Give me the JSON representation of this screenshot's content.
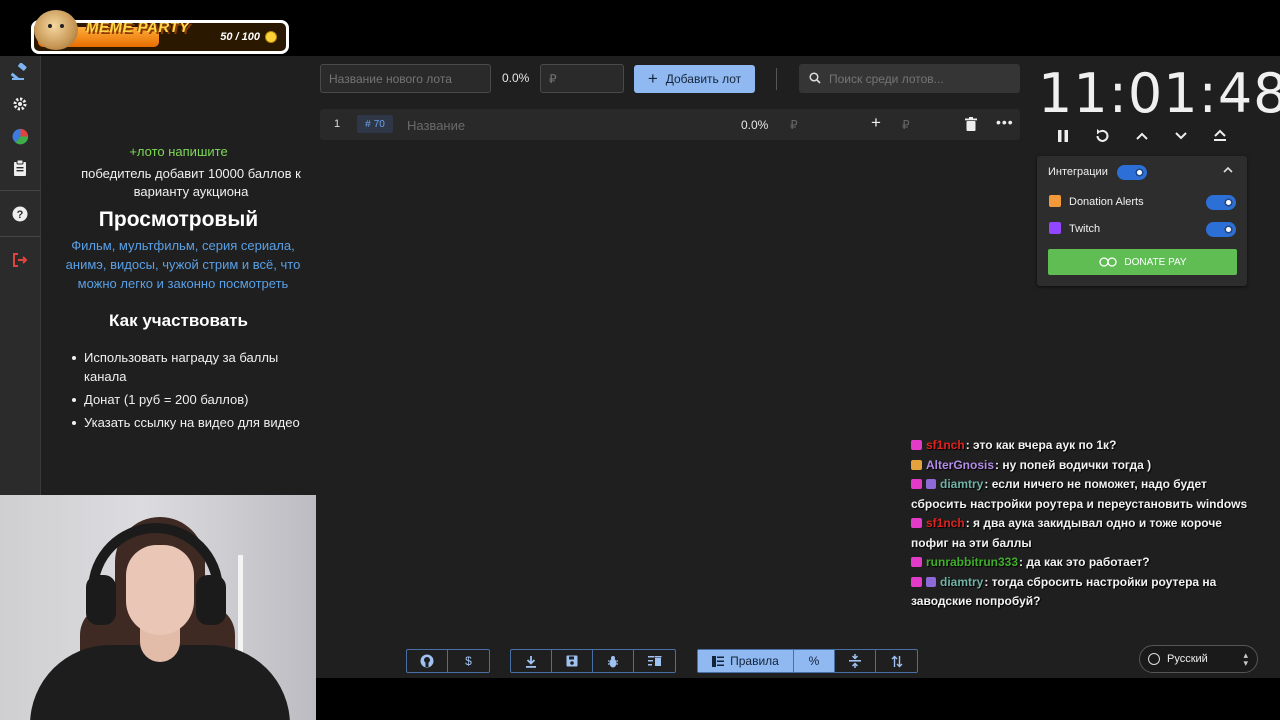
{
  "overlay": {
    "title": "MEME PARTY",
    "counter": "50 / 100",
    "progress": 0.5
  },
  "nav": {
    "items": [
      "auction-icon",
      "settings-icon",
      "stats-icon",
      "clipboard-icon",
      "help-icon",
      "logout-icon"
    ]
  },
  "rules": {
    "line1": "+лото напишите",
    "line2": "победитель добавит 10000 баллов к варианту аукциона",
    "heading": "Просмотровый",
    "description": "Фильм, мультфильм, серия сериала, анимэ, видосы, чужой стрим и всё, что можно легко и законно посмотреть",
    "subheading": "Как участвовать",
    "list": [
      "Использовать награду за баллы канала",
      "Донат (1 руб = 200 баллов)",
      "Указать ссылку на видео для видео"
    ]
  },
  "new_lot": {
    "name_placeholder": "Название нового лота",
    "percent": "0.0%",
    "amount_placeholder": "₽",
    "add_label": "Добавить лот"
  },
  "search": {
    "placeholder": "Поиск среди лотов..."
  },
  "lot": {
    "index": "1",
    "id": "70",
    "id_prefix": "#",
    "name_placeholder": "Название",
    "percent": "0.0%",
    "currency": "₽",
    "add_currency": "₽"
  },
  "timer": {
    "value": "11:01:48"
  },
  "integrations": {
    "title": "Интеграции",
    "services": [
      {
        "name": "Donation Alerts",
        "enabled": true,
        "color": "#f29a3a"
      },
      {
        "name": "Twitch",
        "enabled": true,
        "color": "#9146ff"
      }
    ],
    "donate_pay": "DONATE PAY"
  },
  "chat": [
    {
      "badges": [
        "pink"
      ],
      "nick": "sf1nch",
      "color": "#e0221f",
      "text": ": это как вчера аук по 1к?"
    },
    {
      "badges": [
        "crown"
      ],
      "nick": "AlterGnosis",
      "color": "#b28ce6",
      "text": ": ну попей водички тогда )"
    },
    {
      "badges": [
        "pink",
        "sub"
      ],
      "nick": "diamtry",
      "color": "#6fb3a6",
      "text": ": если ничего не поможет, надо будет сбросить настройки роутера и переустановить windows"
    },
    {
      "badges": [
        "pink"
      ],
      "nick": "sf1nch",
      "color": "#e0221f",
      "text": ": я два аука закидывал одно и тоже короче пофиг на эти баллы"
    },
    {
      "badges": [
        "pink"
      ],
      "nick": "runrabbitrun333",
      "color": "#3fae2a",
      "text": ": да как это работает?"
    },
    {
      "badges": [
        "pink",
        "sub"
      ],
      "nick": "diamtry",
      "color": "#6fb3a6",
      "text": ": тогда сбросить настройки роутера на заводские попробуй?"
    }
  ],
  "toolbar": {
    "rules_label": "Правила",
    "percent_icon": "%",
    "dollar_icon": "$"
  },
  "language": {
    "selected": "Русский"
  }
}
